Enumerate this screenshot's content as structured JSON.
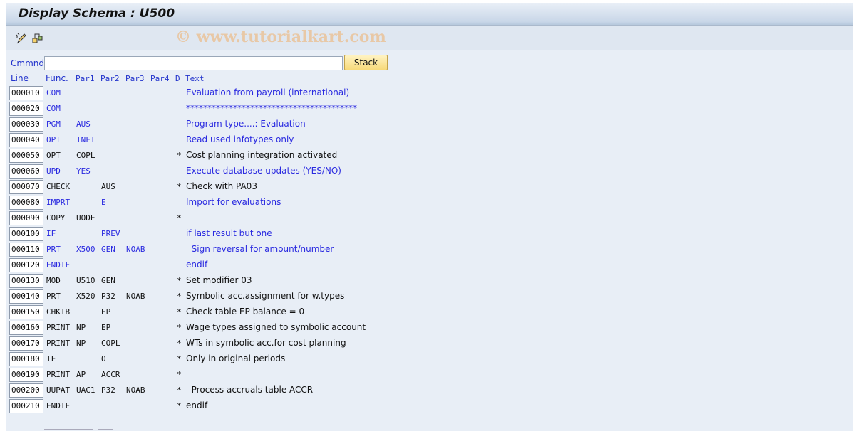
{
  "title": "Display Schema : U500",
  "watermark": "© www.tutorialkart.com",
  "toolbar": {
    "icons": [
      "change-edit-icon",
      "other-object-icon"
    ]
  },
  "command": {
    "label": "Cmmnd",
    "value": "",
    "button": "Stack"
  },
  "columns": {
    "line": "Line",
    "func": "Func.",
    "par1": "Par1",
    "par2": "Par2",
    "par3": "Par3",
    "par4": "Par4",
    "d": "D",
    "text": "Text"
  },
  "colors": {
    "active": "#2a2ae0",
    "inactive": "#111111"
  },
  "rows": [
    {
      "line": "000010",
      "func": "COM",
      "par1": "",
      "par2": "",
      "par3": "",
      "par4": "",
      "d": "",
      "text": "Evaluation from payroll (international)",
      "active": true
    },
    {
      "line": "000020",
      "func": "COM",
      "par1": "",
      "par2": "",
      "par3": "",
      "par4": "",
      "d": "",
      "text": "****************************************",
      "active": true
    },
    {
      "line": "000030",
      "func": "PGM",
      "par1": "AUS",
      "par2": "",
      "par3": "",
      "par4": "",
      "d": "",
      "text": "Program type....: Evaluation",
      "active": true
    },
    {
      "line": "000040",
      "func": "OPT",
      "par1": "INFT",
      "par2": "",
      "par3": "",
      "par4": "",
      "d": "",
      "text": "Read used infotypes only",
      "active": true
    },
    {
      "line": "000050",
      "func": "OPT",
      "par1": "COPL",
      "par2": "",
      "par3": "",
      "par4": "",
      "d": "*",
      "text": "Cost planning integration activated",
      "active": false
    },
    {
      "line": "000060",
      "func": "UPD",
      "par1": "YES",
      "par2": "",
      "par3": "",
      "par4": "",
      "d": "",
      "text": "Execute database updates (YES/NO)",
      "active": true
    },
    {
      "line": "000070",
      "func": "CHECK",
      "par1": "",
      "par2": "AUS",
      "par3": "",
      "par4": "",
      "d": "*",
      "text": "Check with PA03",
      "active": false
    },
    {
      "line": "000080",
      "func": "IMPRT",
      "par1": "",
      "par2": "E",
      "par3": "",
      "par4": "",
      "d": "",
      "text": "Import for evaluations",
      "active": true
    },
    {
      "line": "000090",
      "func": "COPY",
      "par1": "UODE",
      "par2": "",
      "par3": "",
      "par4": "",
      "d": "*",
      "text": "",
      "active": false
    },
    {
      "line": "000100",
      "func": "IF",
      "par1": "",
      "par2": "PREV",
      "par3": "",
      "par4": "",
      "d": "",
      "text": "if last result but one",
      "active": true
    },
    {
      "line": "000110",
      "func": "PRT",
      "par1": "X500",
      "par2": "GEN",
      "par3": "NOAB",
      "par4": "",
      "d": "",
      "text": "  Sign reversal for amount/number",
      "active": true
    },
    {
      "line": "000120",
      "func": "ENDIF",
      "par1": "",
      "par2": "",
      "par3": "",
      "par4": "",
      "d": "",
      "text": "endif",
      "active": true
    },
    {
      "line": "000130",
      "func": "MOD",
      "par1": "U510",
      "par2": "GEN",
      "par3": "",
      "par4": "",
      "d": "*",
      "text": "Set modifier 03",
      "active": false
    },
    {
      "line": "000140",
      "func": "PRT",
      "par1": "X520",
      "par2": "P32",
      "par3": "NOAB",
      "par4": "",
      "d": "*",
      "text": "Symbolic acc.assignment for w.types",
      "active": false
    },
    {
      "line": "000150",
      "func": "CHKTB",
      "par1": "",
      "par2": "EP",
      "par3": "",
      "par4": "",
      "d": "*",
      "text": "Check table EP balance = 0",
      "active": false
    },
    {
      "line": "000160",
      "func": "PRINT",
      "par1": "NP",
      "par2": "EP",
      "par3": "",
      "par4": "",
      "d": "*",
      "text": "Wage types assigned to symbolic account",
      "active": false
    },
    {
      "line": "000170",
      "func": "PRINT",
      "par1": "NP",
      "par2": "COPL",
      "par3": "",
      "par4": "",
      "d": "*",
      "text": "WTs in symbolic acc.for cost planning",
      "active": false
    },
    {
      "line": "000180",
      "func": "IF",
      "par1": "",
      "par2": "O",
      "par3": "",
      "par4": "",
      "d": "*",
      "text": "Only in original periods",
      "active": false
    },
    {
      "line": "000190",
      "func": "PRINT",
      "par1": "AP",
      "par2": "ACCR",
      "par3": "",
      "par4": "",
      "d": "*",
      "text": "",
      "active": false
    },
    {
      "line": "000200",
      "func": "UUPAT",
      "par1": "UAC1",
      "par2": "P32",
      "par3": "NOAB",
      "par4": "",
      "d": "*",
      "text": "  Process accruals table ACCR",
      "active": false
    },
    {
      "line": "000210",
      "func": "ENDIF",
      "par1": "",
      "par2": "",
      "par3": "",
      "par4": "",
      "d": "*",
      "text": "endif",
      "active": false
    }
  ]
}
